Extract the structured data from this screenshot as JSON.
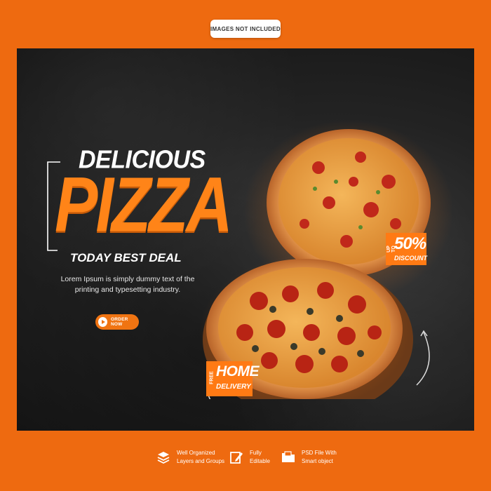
{
  "top_badge": "IMAGES NOT INCLUDED",
  "banner": {
    "heading_small": "DELICIOUS",
    "heading_big": "PIZZA",
    "subheading": "TODAY BEST DEAL",
    "description": "Lorem Ipsum is simply dummy text of the printing and typesetting industry.",
    "order_button": "ORDER NOW",
    "discount": {
      "upto": "UP TO",
      "percent": "50%",
      "label": "DISCOUNT"
    },
    "delivery": {
      "free": "FREE",
      "home": "HOME",
      "label": "DELIVERY"
    }
  },
  "features": [
    {
      "icon": "layers-icon",
      "line1": "Well Organized",
      "line2": "Layers and Groups"
    },
    {
      "icon": "edit-icon",
      "line1": "Fully",
      "line2": "Editable"
    },
    {
      "icon": "folder-icon",
      "line1": "PSD File With",
      "line2": "Smart object"
    }
  ],
  "colors": {
    "accent": "#ff7a14",
    "background": "#ee6a10",
    "banner": "#1c1c1c"
  }
}
